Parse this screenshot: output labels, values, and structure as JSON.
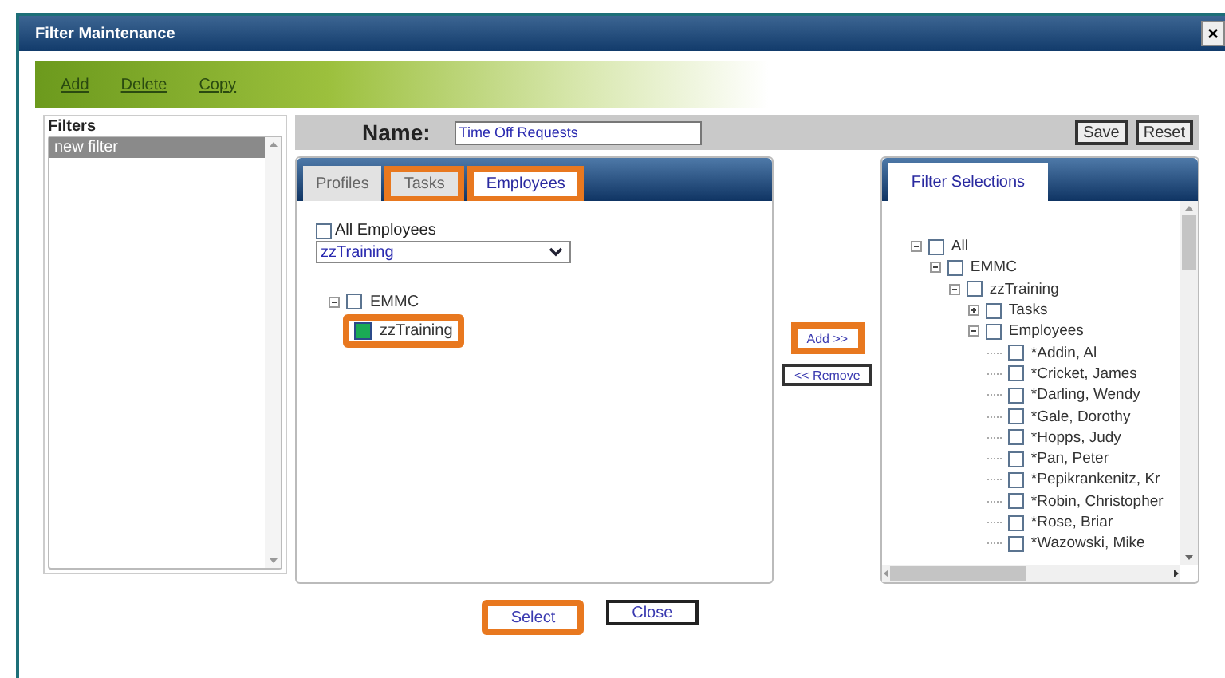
{
  "window": {
    "title": "Filter Maintenance",
    "close": "×"
  },
  "toolbar": [
    "Add",
    "Delete",
    "Copy"
  ],
  "filters": {
    "title": "Filters",
    "items": [
      {
        "label": "new filter",
        "selected": true
      }
    ]
  },
  "name_bar": {
    "label": "Name:",
    "value": "Time Off Requests",
    "buttons": [
      "Save",
      "Reset"
    ]
  },
  "tabs": [
    {
      "label": "Profiles",
      "selected": false,
      "highlighted": false
    },
    {
      "label": "Tasks",
      "selected": false,
      "highlighted": true
    },
    {
      "label": "Employees",
      "selected": true,
      "highlighted": true
    }
  ],
  "employees_panel": {
    "all_checkbox": {
      "label": "All Employees",
      "checked": false
    },
    "group_select": {
      "value": "zzTraining"
    },
    "tree": [
      {
        "label": "EMMC",
        "checked": false,
        "expanded": true,
        "highlighted": false,
        "children": [
          {
            "label": "zzTraining",
            "checked": true,
            "highlighted": true
          }
        ]
      }
    ]
  },
  "move_buttons": [
    {
      "label": "Add >>",
      "highlighted": true
    },
    {
      "label": "<< Remove",
      "highlighted": false
    }
  ],
  "selections_panel": {
    "tab": "Filter Selections",
    "tree": [
      {
        "label": "All",
        "checked": false,
        "expanded": true,
        "children": [
          {
            "label": "EMMC",
            "checked": false,
            "expanded": true,
            "children": [
              {
                "label": "zzTraining",
                "checked": false,
                "expanded": true,
                "children": [
                  {
                    "label": "Tasks",
                    "checked": false,
                    "expanded": false
                  },
                  {
                    "label": "Employees",
                    "checked": false,
                    "expanded": true,
                    "children": [
                      {
                        "label": "*Addin, Al",
                        "checked": false
                      },
                      {
                        "label": "*Cricket, James",
                        "checked": false
                      },
                      {
                        "label": "*Darling, Wendy",
                        "checked": false
                      },
                      {
                        "label": "*Gale, Dorothy",
                        "checked": false
                      },
                      {
                        "label": "*Hopps, Judy",
                        "checked": false
                      },
                      {
                        "label": "*Pan, Peter",
                        "checked": false
                      },
                      {
                        "label": "*Pepikrankenitz, Kr",
                        "checked": false
                      },
                      {
                        "label": "*Robin, Christopher",
                        "checked": false
                      },
                      {
                        "label": "*Rose, Briar",
                        "checked": false
                      },
                      {
                        "label": "*Wazowski, Mike",
                        "checked": false
                      }
                    ]
                  }
                ]
              }
            ]
          }
        ]
      }
    ]
  },
  "footer_buttons": [
    {
      "label": "Select",
      "highlighted": true
    },
    {
      "label": "Close",
      "highlighted": false
    }
  ]
}
